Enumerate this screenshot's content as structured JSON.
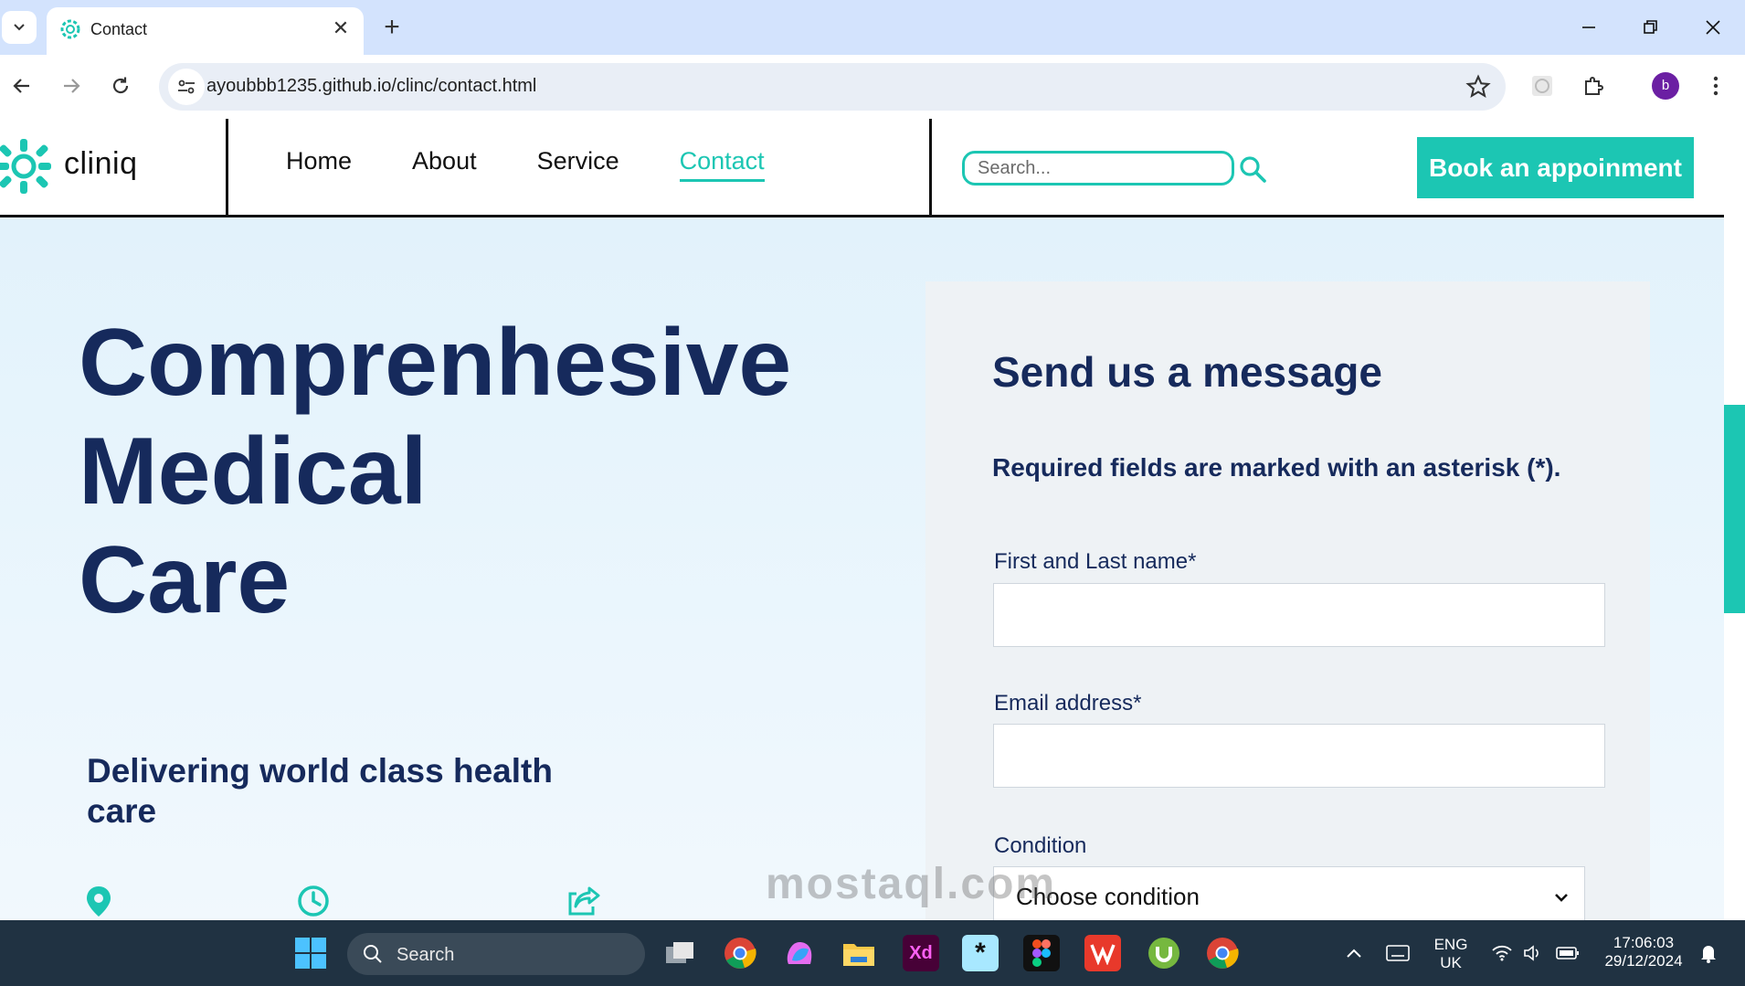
{
  "browser": {
    "tab_title": "Contact",
    "url": "ayoubbb1235.github.io/clinc/contact.html",
    "profile_initial": "b"
  },
  "site": {
    "logo_text": "cliniq",
    "nav": [
      {
        "label": "Home"
      },
      {
        "label": "About"
      },
      {
        "label": "Service"
      },
      {
        "label": "Contact",
        "active": true
      }
    ],
    "search_placeholder": "Search...",
    "book_button": "Book an appoinment",
    "accent_color": "#1cc6b3",
    "heading_color": "#162a5c"
  },
  "hero": {
    "title_lines": [
      "Comprenhesive",
      "Medical",
      "Care"
    ],
    "subtitle": "Delivering world class health care",
    "info_icons": [
      "location-pin-icon",
      "clock-icon",
      "share-icon"
    ]
  },
  "form": {
    "title": "Send us a message",
    "note": "Required fields are marked with an asterisk (*).",
    "name_label": "First and Last name*",
    "email_label": "Email address*",
    "condition_label": "Condition",
    "condition_value": "Choose condition"
  },
  "watermark": "mostaql.com",
  "taskbar": {
    "search_label": "Search",
    "lang_top": "ENG",
    "lang_bottom": "UK",
    "time": "17:06:03",
    "date": "29/12/2024"
  }
}
